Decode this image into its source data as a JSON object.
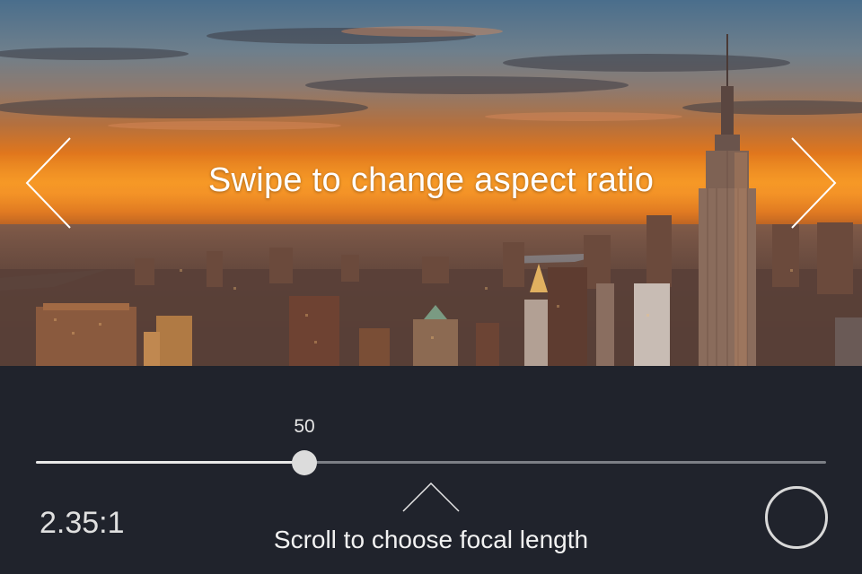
{
  "viewfinder": {
    "hint": "Swipe to change aspect ratio",
    "prev_icon": "chevron-left-icon",
    "next_icon": "chevron-right-icon",
    "scene": "city skyline at sunset"
  },
  "controls": {
    "focal_length": {
      "value": "50",
      "position_fraction": 0.34,
      "track_color": "#7c7f86",
      "fill_color": "#e8e8e8"
    },
    "aspect_ratio": "2.35:1",
    "scroll_hint": "Scroll to choose focal length",
    "scroll_icon": "chevron-up-icon",
    "shutter_icon": "shutter-circle-icon"
  },
  "colors": {
    "panel_background": "#20232c",
    "sunset_orange": "#f0901c"
  }
}
